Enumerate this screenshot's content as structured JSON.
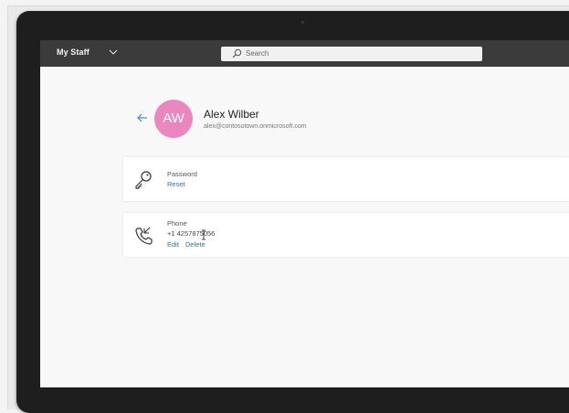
{
  "app": {
    "title": "My Staff",
    "search_placeholder": "Search"
  },
  "profile": {
    "initials": "AW",
    "name": "Alex Wilber",
    "email": "alex@contosotown.onmicrosoft.com",
    "avatar_color": "#ea87bf"
  },
  "password_card": {
    "label": "Password",
    "action": "Reset",
    "icon": "key-icon"
  },
  "phone_card": {
    "label": "Phone",
    "number": "+1 4257875056",
    "edit": "Edit",
    "delete": "Delete",
    "icon": "phone-icon"
  },
  "colors": {
    "appbar": "#3b3b3b",
    "link": "#2d6fc4",
    "background": "#f8f8f8"
  }
}
